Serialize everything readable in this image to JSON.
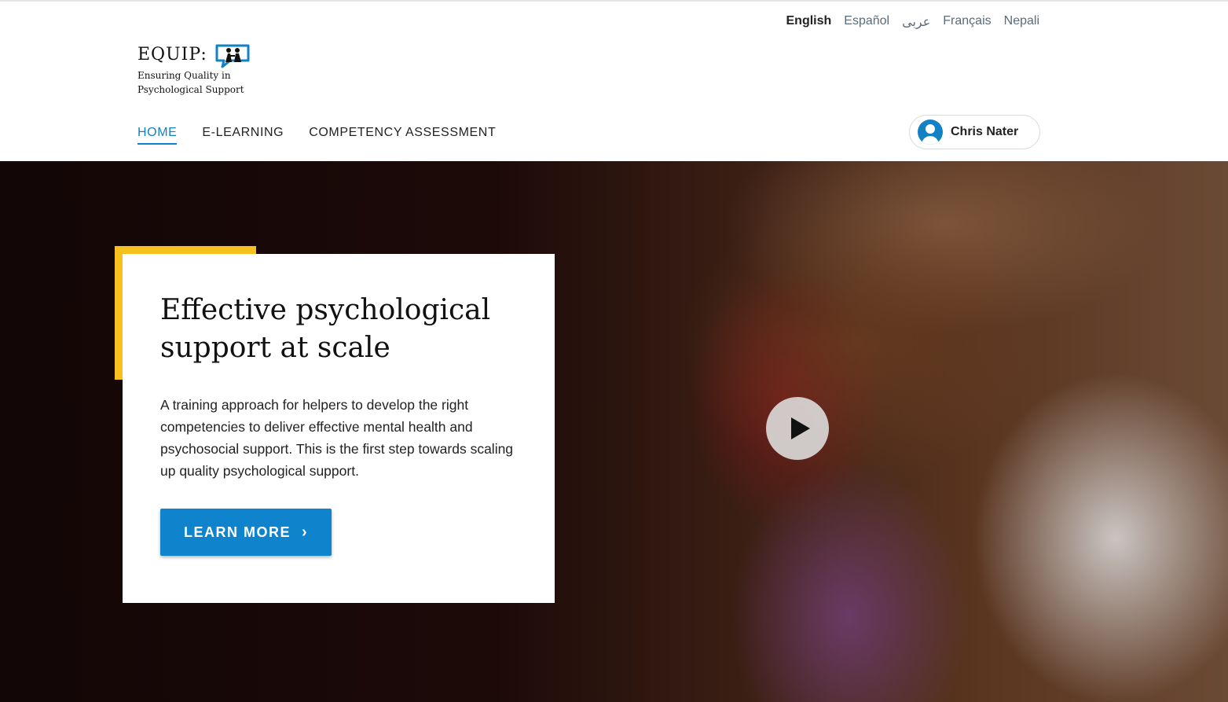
{
  "languages": [
    {
      "label": "English",
      "active": true
    },
    {
      "label": "Español",
      "active": false
    },
    {
      "label": "عربى",
      "active": false
    },
    {
      "label": "Français",
      "active": false
    },
    {
      "label": "Nepali",
      "active": false
    }
  ],
  "logo": {
    "title": "EQUIP:",
    "subtitle_line1": "Ensuring Quality in",
    "subtitle_line2": "Psychological Support"
  },
  "nav": {
    "home": "HOME",
    "elearning": "E-LEARNING",
    "competency": "COMPETENCY ASSESSMENT"
  },
  "user": {
    "name": "Chris Nater",
    "icon": "user-circle-icon"
  },
  "hero": {
    "title_line1": "Effective psychological",
    "title_line2": "support at scale",
    "description": "A training approach for helpers to develop the right competencies to deliver effective mental health and psychosocial support. This is the first step towards scaling up quality psychological support.",
    "button_label": "LEARN MORE",
    "button_icon": "chevron-right-icon",
    "video_icon": "play-icon"
  },
  "colors": {
    "accent_blue": "#0f83cb",
    "accent_yellow": "#f6c11c"
  }
}
